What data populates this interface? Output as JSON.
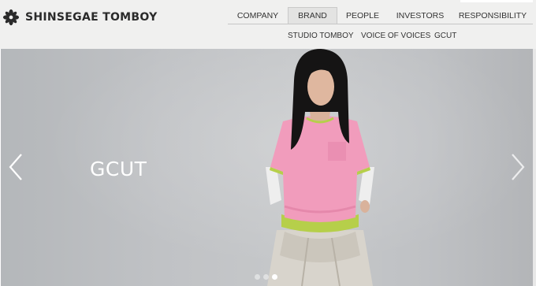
{
  "brand": {
    "name": "SHINSEGAE TOMBOY"
  },
  "nav": {
    "items": [
      {
        "label": "COMPANY"
      },
      {
        "label": "BRAND"
      },
      {
        "label": "PEOPLE"
      },
      {
        "label": "INVESTORS"
      },
      {
        "label": "RESPONSIBILITY"
      }
    ],
    "active": "BRAND"
  },
  "subnav": {
    "items": [
      {
        "label": "STUDIO TOMBOY"
      },
      {
        "label": "VOICE OF VOICES"
      },
      {
        "label": "GCUT"
      }
    ]
  },
  "hero": {
    "title": "GCUT",
    "slide_count": 3,
    "active_slide": 3
  },
  "colors": {
    "header_bg": "#f0f0ef",
    "shirt": "#f19cbc",
    "accent_green": "#b6cf4a"
  }
}
